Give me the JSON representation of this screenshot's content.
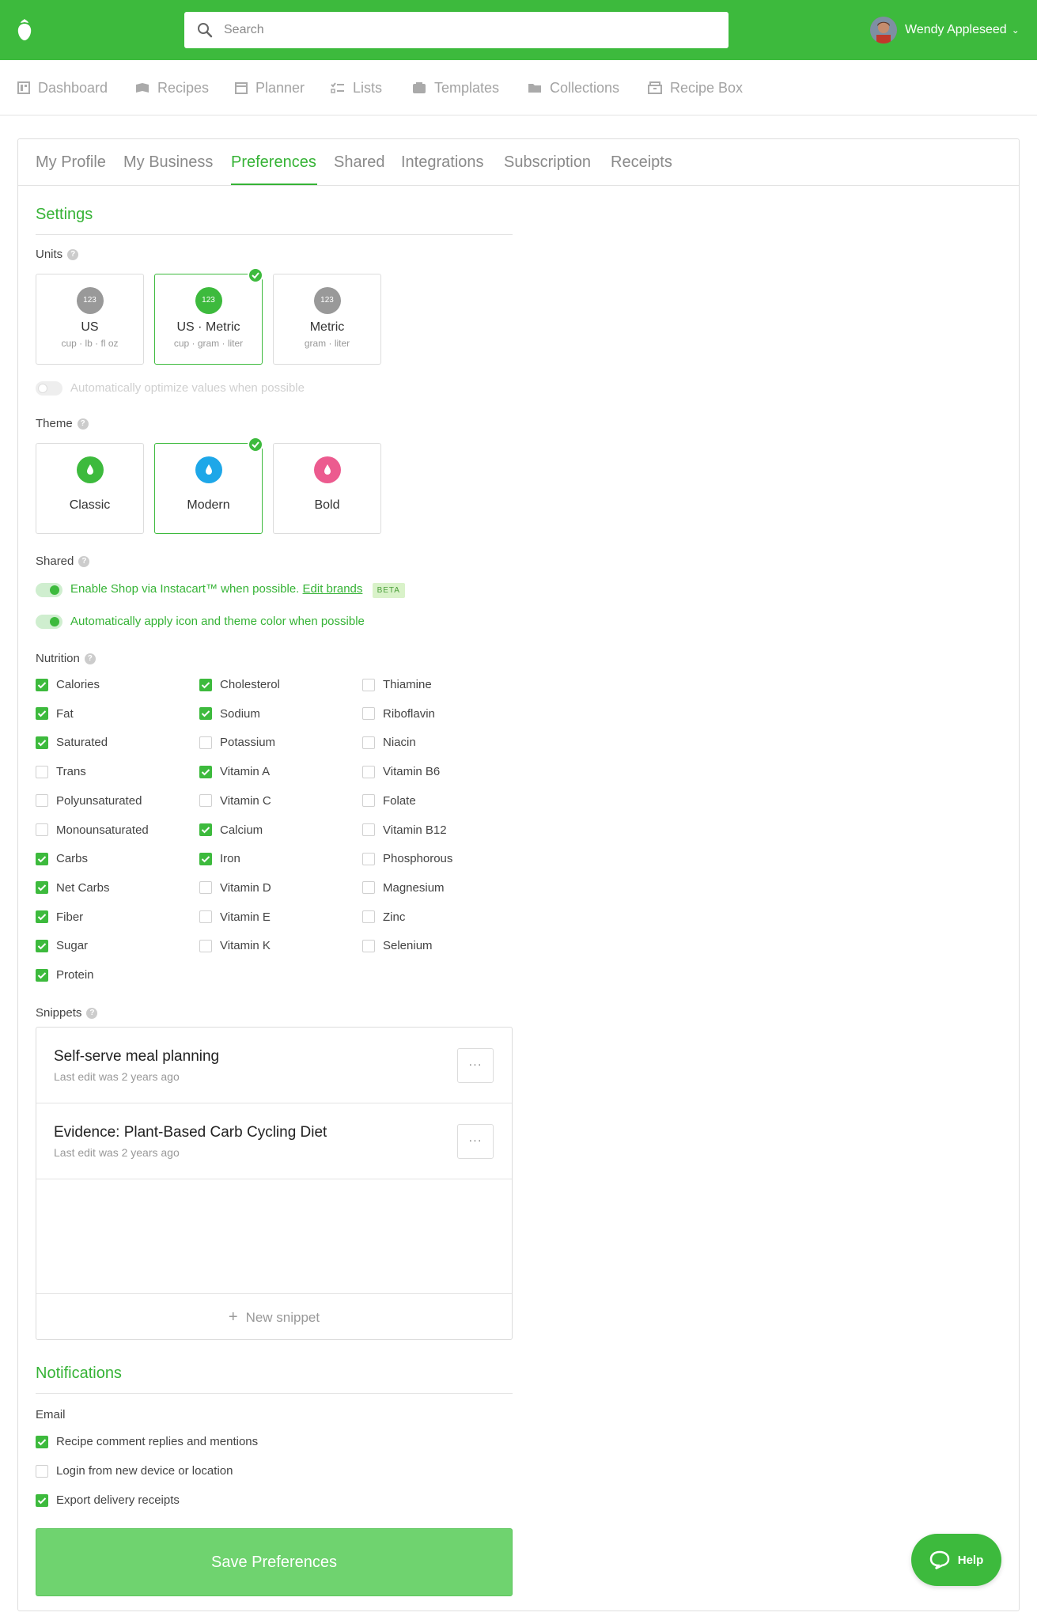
{
  "colors": {
    "accent": "#3dba3d",
    "accent_text": "#36b336",
    "muted": "#a3a3a3"
  },
  "topbar": {
    "search_placeholder": "Search",
    "user_name": "Wendy Appleseed"
  },
  "nav": {
    "items": [
      {
        "label": "Dashboard",
        "icon": "dashboard-icon"
      },
      {
        "label": "Recipes",
        "icon": "recipes-icon"
      },
      {
        "label": "Planner",
        "icon": "planner-icon"
      },
      {
        "label": "Lists",
        "icon": "lists-icon"
      },
      {
        "label": "Templates",
        "icon": "templates-icon"
      },
      {
        "label": "Collections",
        "icon": "collections-icon"
      },
      {
        "label": "Recipe Box",
        "icon": "recipe-box-icon"
      }
    ]
  },
  "tabs": [
    "My Profile",
    "My Business",
    "Preferences",
    "Shared",
    "Integrations",
    "Subscription",
    "Receipts"
  ],
  "active_tab": "Preferences",
  "settings": {
    "title": "Settings",
    "units": {
      "label": "Units",
      "options": [
        {
          "icon_text": "123",
          "title": "US",
          "sub": "cup · lb · fl oz",
          "selected": false
        },
        {
          "icon_text": "123",
          "title": "US · Metric",
          "sub": "cup · gram · liter",
          "selected": true
        },
        {
          "icon_text": "123",
          "title": "Metric",
          "sub": "gram · liter",
          "selected": false
        }
      ],
      "optimize_toggle": "Automatically optimize values when possible"
    },
    "theme": {
      "label": "Theme",
      "options": [
        {
          "title": "Classic",
          "color": "#3dba3d",
          "selected": false
        },
        {
          "title": "Modern",
          "color": "#1ea7e8",
          "selected": true
        },
        {
          "title": "Bold",
          "color": "#ec5b8f",
          "selected": false
        }
      ]
    },
    "shared": {
      "label": "Shared",
      "instacart_text": "Enable Shop via Instacart™ when possible.",
      "edit_brands": "Edit brands",
      "beta": "BETA",
      "auto_apply": "Automatically apply icon and theme color when possible"
    },
    "nutrition": {
      "label": "Nutrition",
      "col1": [
        {
          "label": "Calories",
          "checked": true
        },
        {
          "label": "Fat",
          "checked": true
        },
        {
          "label": "Saturated",
          "checked": true
        },
        {
          "label": "Trans",
          "checked": false
        },
        {
          "label": "Polyunsaturated",
          "checked": false
        },
        {
          "label": "Monounsaturated",
          "checked": false
        },
        {
          "label": "Carbs",
          "checked": true
        },
        {
          "label": "Net Carbs",
          "checked": true
        },
        {
          "label": "Fiber",
          "checked": true
        },
        {
          "label": "Sugar",
          "checked": true
        },
        {
          "label": "Protein",
          "checked": true
        }
      ],
      "col2": [
        {
          "label": "Cholesterol",
          "checked": true
        },
        {
          "label": "Sodium",
          "checked": true
        },
        {
          "label": "Potassium",
          "checked": false
        },
        {
          "label": "Vitamin A",
          "checked": true
        },
        {
          "label": "Vitamin C",
          "checked": false
        },
        {
          "label": "Calcium",
          "checked": true
        },
        {
          "label": "Iron",
          "checked": true
        },
        {
          "label": "Vitamin D",
          "checked": false
        },
        {
          "label": "Vitamin E",
          "checked": false
        },
        {
          "label": "Vitamin K",
          "checked": false
        }
      ],
      "col3": [
        {
          "label": "Thiamine",
          "checked": false
        },
        {
          "label": "Riboflavin",
          "checked": false
        },
        {
          "label": "Niacin",
          "checked": false
        },
        {
          "label": "Vitamin B6",
          "checked": false
        },
        {
          "label": "Folate",
          "checked": false
        },
        {
          "label": "Vitamin B12",
          "checked": false
        },
        {
          "label": "Phosphorous",
          "checked": false
        },
        {
          "label": "Magnesium",
          "checked": false
        },
        {
          "label": "Zinc",
          "checked": false
        },
        {
          "label": "Selenium",
          "checked": false
        }
      ]
    },
    "snippets": {
      "label": "Snippets",
      "items": [
        {
          "title": "Self-serve meal planning",
          "subtitle": "Last edit was 2 years ago"
        },
        {
          "title": "Evidence: Plant-Based Carb Cycling Diet",
          "subtitle": "Last edit was 2 years ago"
        }
      ],
      "more": "···",
      "new_label": "New snippet"
    }
  },
  "notifications": {
    "title": "Notifications",
    "email_label": "Email",
    "items": [
      {
        "label": "Recipe comment replies and mentions",
        "checked": true
      },
      {
        "label": "Login from new device or location",
        "checked": false
      },
      {
        "label": "Export delivery receipts",
        "checked": true
      }
    ]
  },
  "save_label": "Save Preferences",
  "help_label": "Help"
}
